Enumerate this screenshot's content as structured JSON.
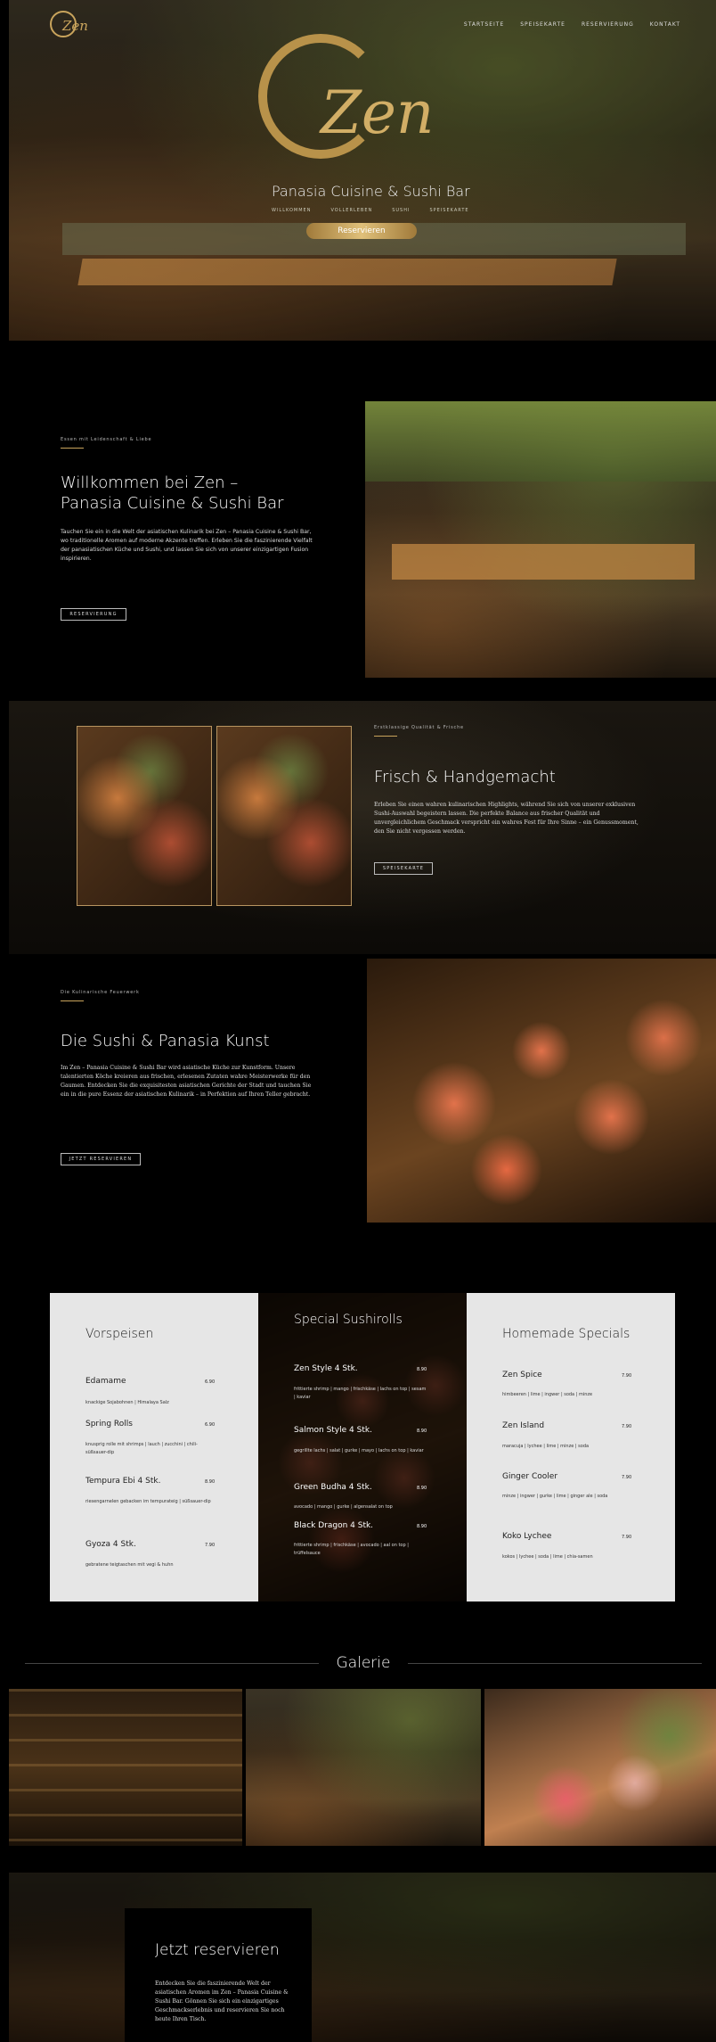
{
  "nav": {
    "logo": "Zen",
    "items": [
      "STARTSEITE",
      "SPEISEKARTE",
      "RESERVIERUNG",
      "KONTAKT"
    ]
  },
  "hero": {
    "logo_text": "Zen",
    "tagline": "Panasia Cuisine & Sushi Bar",
    "sub_items": [
      "WILLKOMMEN",
      "VOLLERLEBEN",
      "SUSHI",
      "SPEISEKARTE"
    ],
    "cta": "Reservieren"
  },
  "welcome": {
    "eyebrow": "Essen mit Leidenschaft & Liebe",
    "title": "Willkommen bei Zen – Panasia Cuisine & Sushi Bar",
    "text": "Tauchen Sie ein in die Welt der asiatischen Kulinarik bei Zen – Panasia Cuisine & Sushi Bar, wo traditionelle Aromen auf moderne Akzente treffen. Erleben Sie die faszinierende Vielfalt der panasiatischen Küche und Sushi, und lassen Sie sich von unserer einzigartigen Fusion inspirieren.",
    "button": "RESERVIERUNG"
  },
  "fresh": {
    "eyebrow": "Erstklassige Qualität & Frische",
    "title": "Frisch & Handgemacht",
    "text": "Erleben Sie einen wahren kulinarischen Highlights, während Sie sich von unserer exklusiven Sushi-Auswahl begeistern lassen. Die perfekte Balance aus frischer Qualität und unvergleichlichem Geschmack verspricht ein wahres Fest für Ihre Sinne – ein Genussmoment, den Sie nicht vergessen werden.",
    "button": "SPEISEKARTE"
  },
  "sushi": {
    "eyebrow": "Die Kulinarische Feuerwerk",
    "title": "Die Sushi & Panasia Kunst",
    "text": "Im Zen – Panasia Cuisine & Sushi Bar wird asiatische Küche zur Kunstform. Unsere talentierten Köche kreieren aus frischen, erlesenen Zutaten wahre Meisterwerke für den Gaumen. Entdecken Sie die exquisitesten asiatischen Gerichte der Stadt und tauchen Sie ein in die pure Essenz der asiatischen Kulinarik – in Perfektion auf Ihren Teller gebracht.",
    "button": "JETZT RESERVIEREN"
  },
  "menu": {
    "starters": {
      "title": "Vorspeisen",
      "items": [
        {
          "name": "Edamame",
          "price": "6.90",
          "desc": "knackige Sojabohnen | Himalaya Salz"
        },
        {
          "name": "Spring Rolls",
          "price": "6.90",
          "desc": "knusprig rolle mit shrimps | lauch | zucchini | chili-süßsauer-dip"
        },
        {
          "name": "Tempura Ebi 4 Stk.",
          "price": "8.90",
          "desc": "riesengarnelen gebacken im tempurateig | süßsauer-dip"
        },
        {
          "name": "Gyoza 4 Stk.",
          "price": "7.90",
          "desc": "gebratene teigtaschen mit vegi & huhn"
        }
      ]
    },
    "rolls": {
      "title": "Special Sushirolls",
      "items": [
        {
          "name": "Zen Style 4 Stk.",
          "price": "8.90",
          "desc": "frittierte shrimp | mango | frischkäse | lachs on top | sesam | kaviar"
        },
        {
          "name": "Salmon Style 4 Stk.",
          "price": "8.90",
          "desc": "gegrillte lachs | salat | gurke | mayo | lachs on top | kaviar"
        },
        {
          "name": "Green Budha 4 Stk.",
          "price": "8.90",
          "desc": "avocado | mango | gurke | algensalat on top"
        },
        {
          "name": "Black Dragon 4 Stk.",
          "price": "8.90",
          "desc": "frittierte shrimp | frischkäse | avocado | aal on top | trüffelsauce"
        }
      ]
    },
    "specials": {
      "title": "Homemade Specials",
      "items": [
        {
          "name": "Zen Spice",
          "price": "7.90",
          "desc": "himbeeren | lime | ingwer | soda | minze"
        },
        {
          "name": "Zen Island",
          "price": "7.90",
          "desc": "maracuja | lychee | lime | minze | soda"
        },
        {
          "name": "Ginger Cooler",
          "price": "7.90",
          "desc": "minze | ingwer | gurke | lime | ginger ale | soda"
        },
        {
          "name": "Koko Lychee",
          "price": "7.90",
          "desc": "kokos | lychee | soda | lime | chia-samen"
        }
      ]
    }
  },
  "gallery": {
    "title": "Galerie"
  },
  "reserve": {
    "title": "Jetzt reservieren",
    "text": "Entdecken Sie die faszinierende Welt der asiatischen Aromen im Zen – Panasia Cuisine & Sushi Bar. Gönnen Sie sich ein einzigartiges Geschmackserlebnis und reservieren Sie noch heute Ihren Tisch."
  }
}
